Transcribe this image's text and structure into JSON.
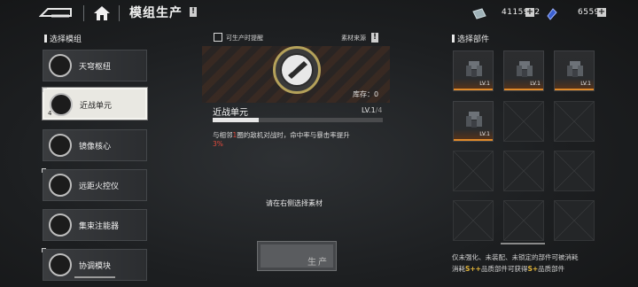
{
  "header": {
    "title": "模组生产",
    "title_info": "!",
    "resources": [
      {
        "icon": "credit-chip-icon",
        "value": "4115912"
      },
      {
        "icon": "blue-crystal-icon",
        "value": "6559"
      }
    ],
    "plus": "+"
  },
  "left_panel": {
    "heading": "选择模组",
    "items": [
      {
        "label": "天穹枢纽",
        "count": "",
        "selected": false
      },
      {
        "label": "近战单元",
        "count": "4",
        "selected": true
      },
      {
        "label": "镜像核心",
        "count": "",
        "selected": false
      },
      {
        "label": "远距火控仪",
        "count": "",
        "selected": false
      },
      {
        "label": "集束注能器",
        "count": "",
        "selected": false
      },
      {
        "label": "协调模块",
        "count": "",
        "selected": false
      }
    ]
  },
  "center": {
    "remind_label": "可生产时提醒",
    "material_source": "素材来源",
    "material_info": "!",
    "stock_label": "库存：",
    "stock_value": "0",
    "module_name": "近战单元",
    "level": "LV.1",
    "level_max": "/4",
    "xp_fraction": 0.27,
    "desc_pre": "与相邻",
    "desc_num": "1",
    "desc_mid": "圈的敌机对战时，命中率与暴击率提升",
    "desc_pct": "3%",
    "hint": "请在右侧选择素材",
    "produce": "生产"
  },
  "right_panel": {
    "heading": "选择部件",
    "parts": [
      {
        "level": "LV.1"
      },
      {
        "level": "LV.1"
      },
      {
        "level": "LV.1"
      },
      {
        "level": "LV.1"
      }
    ],
    "empty_slots": 8,
    "footnote_line1": "仅未强化、未装配、未锁定的部件可被消耗",
    "footnote_line2a": "消耗",
    "footnote_badge1": "S++",
    "footnote_line2b": "品质部件可获得",
    "footnote_badge2": "S+",
    "footnote_line2c": "品质部件"
  },
  "colors": {
    "accent_orange": "#e08a2a",
    "highlight_red": "#e34a3c",
    "gold": "#e0b43a"
  }
}
